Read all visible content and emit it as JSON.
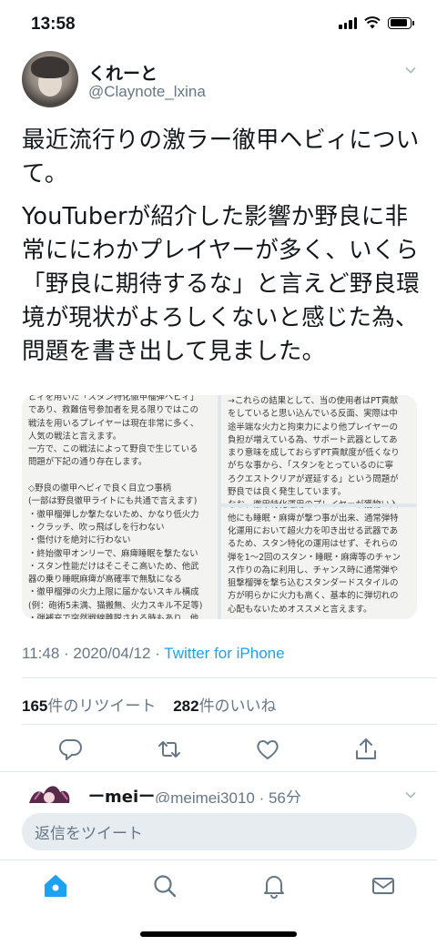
{
  "status_bar": {
    "time": "13:58"
  },
  "tweet": {
    "display_name": "くれーと",
    "handle": "@Claynote_lxina",
    "text_paragraph_1": "最近流行りの激ラー徹甲ヘビィについて。",
    "text_paragraph_2": "YouTuberが紹介した影響か野良に非常ににわかプレイヤーが多く、いくら「野良に期待するな」と言えど野良環境が現状がよろしくないと感じた為、問題を書き出して見ました。",
    "timestamp": "11:48 · 2020/04/12 · ",
    "source": "Twitter for iPhone",
    "retweet_count": "165",
    "retweet_label": "件のリツイート",
    "like_count": "282",
    "like_label": "件のいいね"
  },
  "media": {
    "image_1_text": "ビィを用いた「スタン特化徹甲榴弾ヘビィ」\nであり、救難信号参加者を見る限りではこの\n戦法を用いるプレイヤーは現在非常に多く、\n人気の戦法と言えます。\n一方で、この戦法によって野良で生じている\n問題が下記の通り存在します。\n\n◇野良の徹甲ヘビィで良く目立つ事柄\n(一部は野良徹甲ライトにも共通で言えます)\n・徹甲榴弾しか撃たないため、かなり低火力\n・クラッチ、吹っ飛ばしを行わない\n・傷付けを絶対に行わない\n・終始徹甲オンリーで、麻痺睡眠を撃たない\n・スタン性能だけはそこそこ高いため、他武\n器の乗り睡眠麻痺が高確率で無駄になる\n・徹甲榴弾の火力上限に届かないスキル構成\n(例：砲術5未満、猫搬無、火力スキル不足等)\n・弾補充で突然戦線離脱される時もあり、他",
    "image_2_text": "→これらの結果として、当の使用者はPT貢献\nをしていると思い込んでいる反面、実際は中\n途半端な火力と拘束力により他プレイヤーの\n負担が増えている為、サポート武器としてあ\nまり意味を成しておらずPT貢献度が低くなり\nがちな事から、「スタンをとっているのに寧\nろクエストクリアが遅延する」という問題が\n野良では良く発生しています。\nなお、徹甲特化運用のプレイヤーが獲物い入\n他にも睡眠・麻痺が撃つ事が出来、通常弾特\n化運用において超火力を叩き出せる武器であ\nるため、スタン特化の運用はせず、それらの\n弾を1〜2回のスタン・睡眠・麻痺等のチャン\nス作りの為に利用し、チャンス時に通常弾や\n狙撃榴弾を撃ち込むスタンダードスタイルの\n方が明らかに火力も高く、基本的に弾切れの\n心配もないためオススメと言えます。"
  },
  "reply": {
    "name": "ーmeiー",
    "meta": "@meimei3010 · 56分"
  },
  "compose": {
    "placeholder": "返信をツイート"
  },
  "icons": {
    "status": [
      "cellular-signal-icon",
      "wifi-icon",
      "battery-icon"
    ],
    "actions": [
      "reply-icon",
      "retweet-icon",
      "like-icon",
      "share-icon"
    ],
    "tabs": [
      "home-icon",
      "search-icon",
      "notifications-icon",
      "messages-icon"
    ]
  },
  "colors": {
    "accent": "#1da1f2",
    "secondary_text": "#657786",
    "primary_text": "#14171a"
  }
}
